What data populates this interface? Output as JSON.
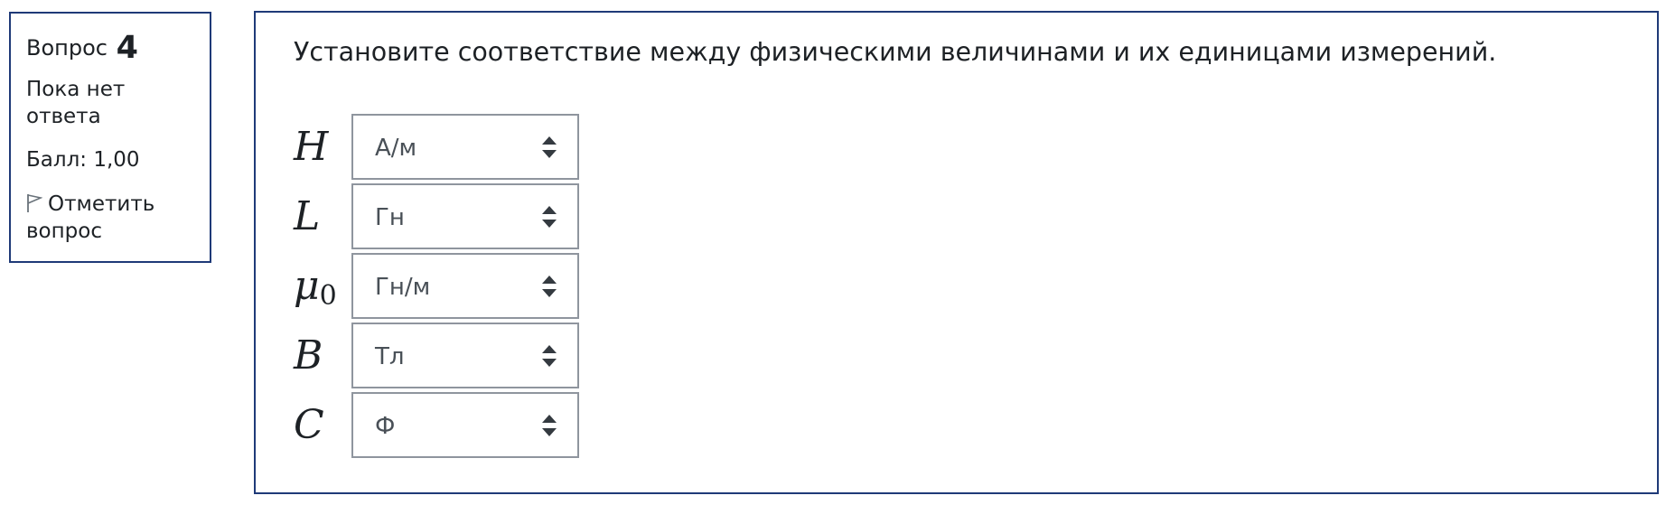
{
  "info": {
    "question_label": "Вопрос",
    "question_number": "4",
    "state": "Пока нет ответа",
    "grade": "Балл: 1,00",
    "flag_label": "Отметить вопрос"
  },
  "question": {
    "text": "Установите соответствие между физическими величинами и их единицами измерений.",
    "rows": [
      {
        "symbol": "H",
        "subscript": "",
        "selected": "А/м"
      },
      {
        "symbol": "L",
        "subscript": "",
        "selected": "Гн"
      },
      {
        "symbol": "μ",
        "subscript": "0",
        "selected": "Гн/м"
      },
      {
        "symbol": "B",
        "subscript": "",
        "selected": "Тл"
      },
      {
        "symbol": "C",
        "subscript": "",
        "selected": "Ф"
      }
    ]
  },
  "icons": {
    "flag": "flag-outline-icon",
    "select_caret": "up-down-caret-icon"
  },
  "colors": {
    "box_border": "#1f3a78",
    "select_border": "#8f959e",
    "select_text": "#495057",
    "text": "#1d2125"
  }
}
